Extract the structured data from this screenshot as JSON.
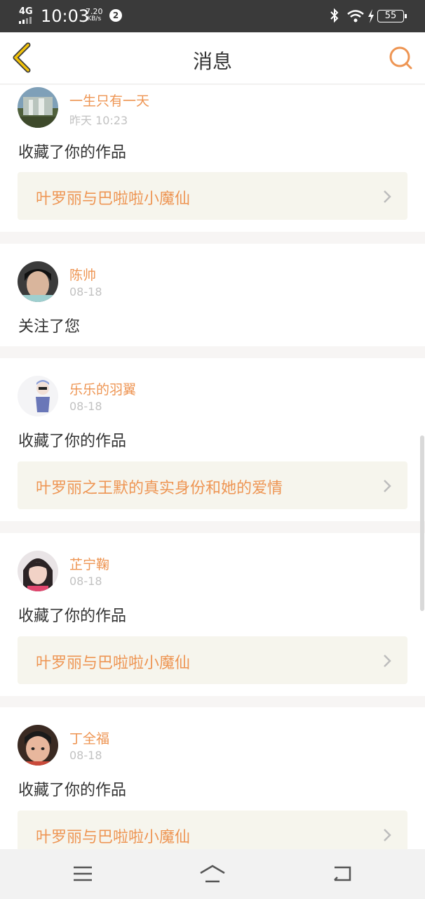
{
  "status_bar": {
    "network": "4G",
    "time": "10:03",
    "speed_value": "7.20",
    "speed_unit": "KB/s",
    "notification_count": "2",
    "battery": "55",
    "icons": [
      "signal-icon",
      "bluetooth-icon",
      "wifi-icon",
      "charging-icon",
      "battery-icon"
    ]
  },
  "header": {
    "title": "消息",
    "back_icon": "chevron-left-icon",
    "search_icon": "search-icon"
  },
  "messages": [
    {
      "user": "一生只有一天",
      "time": "昨天 10:23",
      "action": "收藏了你的作品",
      "work": "叶罗丽与巴啦啦小魔仙"
    },
    {
      "user": "陈帅",
      "time": "08-18",
      "action": "关注了您",
      "work": ""
    },
    {
      "user": "乐乐的羽翼",
      "time": "08-18",
      "action": "收藏了你的作品",
      "work": "叶罗丽之王默的真实身份和她的爱情"
    },
    {
      "user": "芷宁鞠",
      "time": "08-18",
      "action": "收藏了你的作品",
      "work": "叶罗丽与巴啦啦小魔仙"
    },
    {
      "user": "丁全福",
      "time": "08-18",
      "action": "收藏了你的作品",
      "work": "叶罗丽与巴啦啦小魔仙"
    }
  ],
  "nav_bar": {
    "icons": [
      "menu-icon",
      "home-icon",
      "back-icon"
    ]
  },
  "colors": {
    "accent": "#ee9553",
    "work_background": "#f6f5ed",
    "status_bar": "#3a3a3a"
  }
}
